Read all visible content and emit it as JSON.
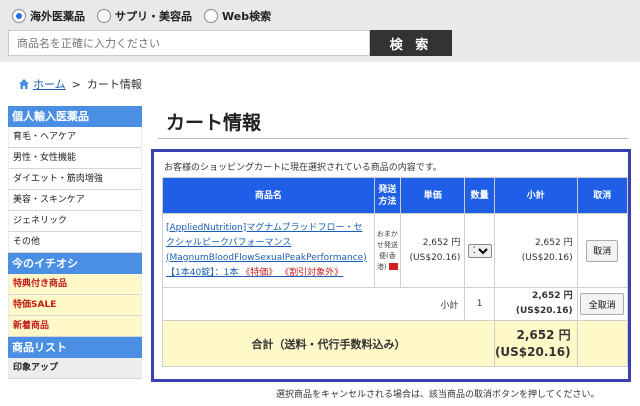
{
  "search": {
    "tabs": [
      {
        "label": "海外医薬品",
        "selected": true
      },
      {
        "label": "サプリ・美容品",
        "selected": false
      },
      {
        "label": "Web検索",
        "selected": false
      }
    ],
    "placeholder": "商品名を正確に入力ください",
    "button_label": "検 索"
  },
  "breadcrumb": {
    "home": "ホーム",
    "separator": ">",
    "current": "カート情報"
  },
  "sidebar": {
    "sections": [
      {
        "heading": "個人輸入医薬品",
        "items": [
          "育毛・ヘアケア",
          "男性・女性機能",
          "ダイエット・筋肉増強",
          "美容・スキンケア",
          "ジェネリック",
          "その他"
        ]
      },
      {
        "heading": "今のイチオシ",
        "items": [
          "特典付き商品",
          "特価SALE",
          "新着商品"
        ]
      },
      {
        "heading": "商品リスト",
        "items": [
          "印象アップ"
        ]
      }
    ]
  },
  "page_title": "カート情報",
  "cart": {
    "note": "お客様のショッピングカートに現在選択されている商品の内容です。",
    "headers": {
      "name": "商品名",
      "ship": "発送\n方法",
      "unit": "単価",
      "qty": "数量",
      "subtotal": "小計",
      "cancel": "取消"
    },
    "item": {
      "name": "[AppliedNutrition]マグナムブラッドフロー・セクシャルピークパフォーマンス(MagnumBloodFlowSexualPeakPerformance)【1本40錠】：1本",
      "tag1": "《特価》",
      "tag2": "《割引対象外》",
      "ship": "おまかせ発送便(香港)",
      "unit_yen": "2,652 円",
      "unit_usd": "(US$20.16)",
      "qty": "1",
      "sub_yen": "2,652 円",
      "sub_usd": "(US$20.16)",
      "cancel_label": "取消"
    },
    "subtotal": {
      "label": "小計",
      "qty": "1",
      "yen": "2,652 円",
      "usd": "(US$20.16)",
      "cancel_all_label": "全取消"
    },
    "total": {
      "label": "合計（送料・代行手数料込み）",
      "yen": "2,652 円",
      "usd": "(US$20.16)"
    }
  },
  "footer_note": "選択商品をキャンセルされる場合は、該当商品の取消ボタンを押してください。"
}
